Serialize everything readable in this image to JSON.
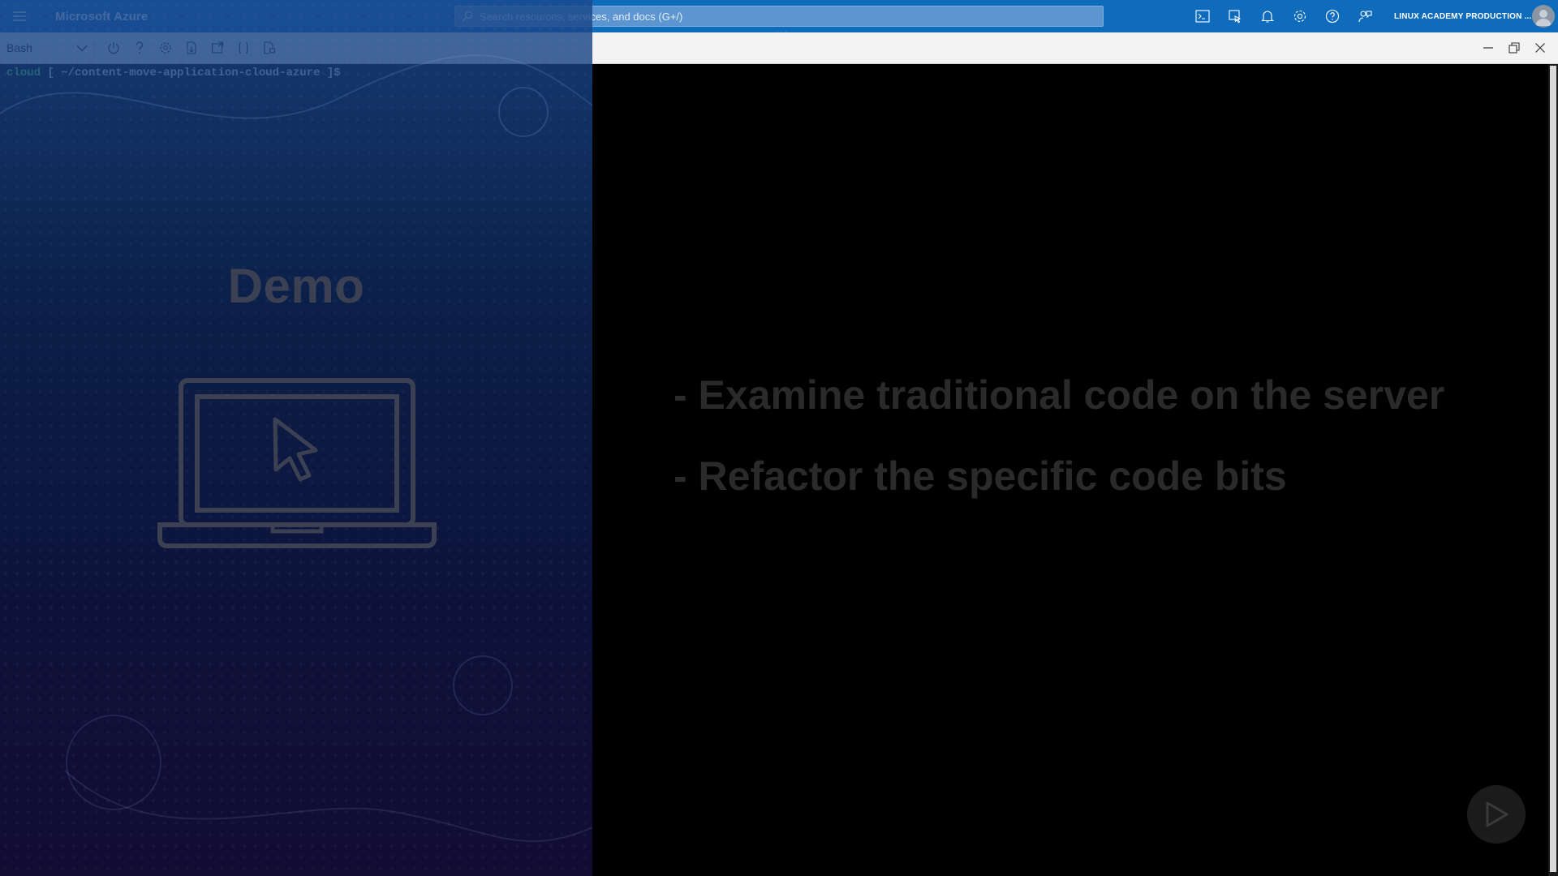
{
  "topbar": {
    "brand": "Microsoft Azure",
    "search_placeholder": "Search resources, services, and docs (G+/)",
    "account_label": "LINUX ACADEMY PRODUCTION ...",
    "icons": [
      "cloud-shell-icon",
      "directory-filter-icon",
      "notifications-icon",
      "settings-icon",
      "help-icon",
      "feedback-icon"
    ]
  },
  "shell": {
    "selected_shell": "Bash",
    "tools": [
      "restart-icon",
      "help-icon",
      "settings-icon",
      "upload-download-icon",
      "open-new-session-icon",
      "editor-braces-icon",
      "web-preview-icon"
    ]
  },
  "terminal": {
    "prompt_host": "cloud",
    "prompt_path": " [ ~/content-move-application-cloud-azure ]$"
  },
  "slide": {
    "title": "Demo",
    "bullets": [
      "- Examine traditional code on the server",
      "- Refactor the specific code bits"
    ]
  },
  "colors": {
    "azure_blue": "#0f6cbd",
    "prompt_green": "#5ee05e"
  }
}
